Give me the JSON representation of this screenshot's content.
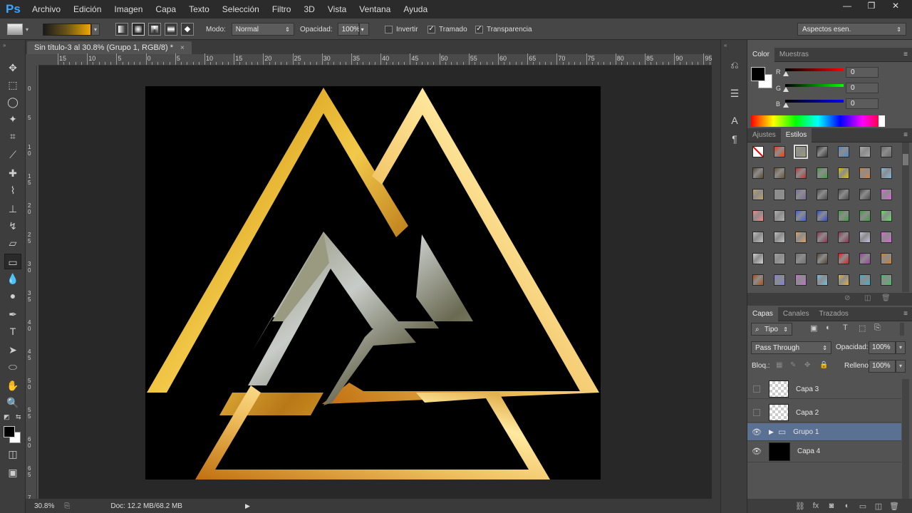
{
  "app": {
    "logo": "Ps"
  },
  "menu": [
    "Archivo",
    "Edición",
    "Imagen",
    "Capa",
    "Texto",
    "Selección",
    "Filtro",
    "3D",
    "Vista",
    "Ventana",
    "Ayuda"
  ],
  "window_controls": {
    "minimize": "—",
    "restore": "❐",
    "close": "✕"
  },
  "options": {
    "mode_label": "Modo:",
    "mode_value": "Normal",
    "opacity_label": "Opacidad:",
    "opacity_value": "100%",
    "invert_label": "Invertir",
    "invert_checked": false,
    "dither_label": "Tramado",
    "dither_checked": true,
    "transparency_label": "Transparencia",
    "transparency_checked": true,
    "gradient_colors": [
      "#1a1a1a",
      "#6b5518",
      "#f0a800"
    ]
  },
  "workspace": {
    "value": "Aspectos esen."
  },
  "document": {
    "tab_title": "Sin título-3 al 30.8% (Grupo 1, RGB/8) *",
    "close": "×",
    "zoom": "30.8%",
    "doc_info": "Doc: 12.2 MB/68.2 MB",
    "ruler_h_labels": [
      "15",
      "10",
      "5",
      "0",
      "5",
      "10",
      "15",
      "20",
      "25",
      "30",
      "35",
      "40",
      "45",
      "50",
      "55",
      "60",
      "65",
      "70",
      "75",
      "80",
      "85",
      "90",
      "95"
    ],
    "ruler_v_labels": [
      "0",
      "5",
      "1 0",
      "1 5",
      "2 0",
      "2 5",
      "3 0",
      "3 5",
      "4 0",
      "4 5",
      "5 0",
      "5 5",
      "6 0",
      "6 5",
      "7"
    ]
  },
  "color_panel": {
    "tabs": [
      "Color",
      "Muestras"
    ],
    "active_tab": "Color",
    "r_label": "R",
    "r_value": "0",
    "g_label": "G",
    "g_value": "0",
    "b_label": "B",
    "b_value": "0",
    "foreground": "#000000",
    "background": "#ffffff"
  },
  "styles_panel": {
    "tabs": [
      "Ajustes",
      "Estilos"
    ],
    "active_tab": "Estilos",
    "swatches": [
      "#ffffff",
      "#ff3a00",
      "#9c9c7a",
      "#333333",
      "#4a8ad0",
      "#a8a8a8",
      "#6a6a6a",
      "#5a4a30",
      "#6a5530",
      "#c83030",
      "#40a040",
      "#e0c000",
      "#d88040",
      "#80b8e0",
      "#c0a060",
      "#909090",
      "#7a6aa0",
      "#4a4a4a",
      "#4a4a4a",
      "#4a4a4a",
      "#e060e0",
      "#ff8080",
      "#b0b0b0",
      "#4060e0",
      "#3050d0",
      "#40a040",
      "#40a040",
      "#60e060",
      "#c0c0c0",
      "#c0c0c0",
      "#e0a060",
      "#903050",
      "#903050",
      "#c0c0e0",
      "#e060e0",
      "#d0d0d0",
      "#a0a0a0",
      "#707070",
      "#504030",
      "#e02020",
      "#a040a0",
      "#d08030",
      "#b05010",
      "#8080e0",
      "#c070d0",
      "#70c0e0",
      "#e0b040",
      "#40b0d0",
      "#40c060"
    ]
  },
  "layers_panel": {
    "tabs": [
      "Capas",
      "Canales",
      "Trazados"
    ],
    "active_tab": "Capas",
    "kind_filter": "Tipo",
    "blend_mode": "Pass Through",
    "opacity_label": "Opacidad:",
    "opacity_value": "100%",
    "lock_label": "Bloq.:",
    "fill_label": "Relleno:",
    "fill_value": "100%",
    "layers": [
      {
        "name": "Capa 3",
        "visible": false,
        "thumb": "checker"
      },
      {
        "name": "Capa 2",
        "visible": false,
        "thumb": "checker"
      },
      {
        "name": "Grupo 1",
        "visible": true,
        "thumb": "folder",
        "selected": true
      },
      {
        "name": "Capa 4",
        "visible": true,
        "thumb": "black"
      }
    ],
    "footer_icons": [
      "link-icon",
      "fx-icon",
      "mask-icon",
      "adjustment-icon",
      "group-icon",
      "new-layer-icon",
      "trash-icon"
    ]
  }
}
